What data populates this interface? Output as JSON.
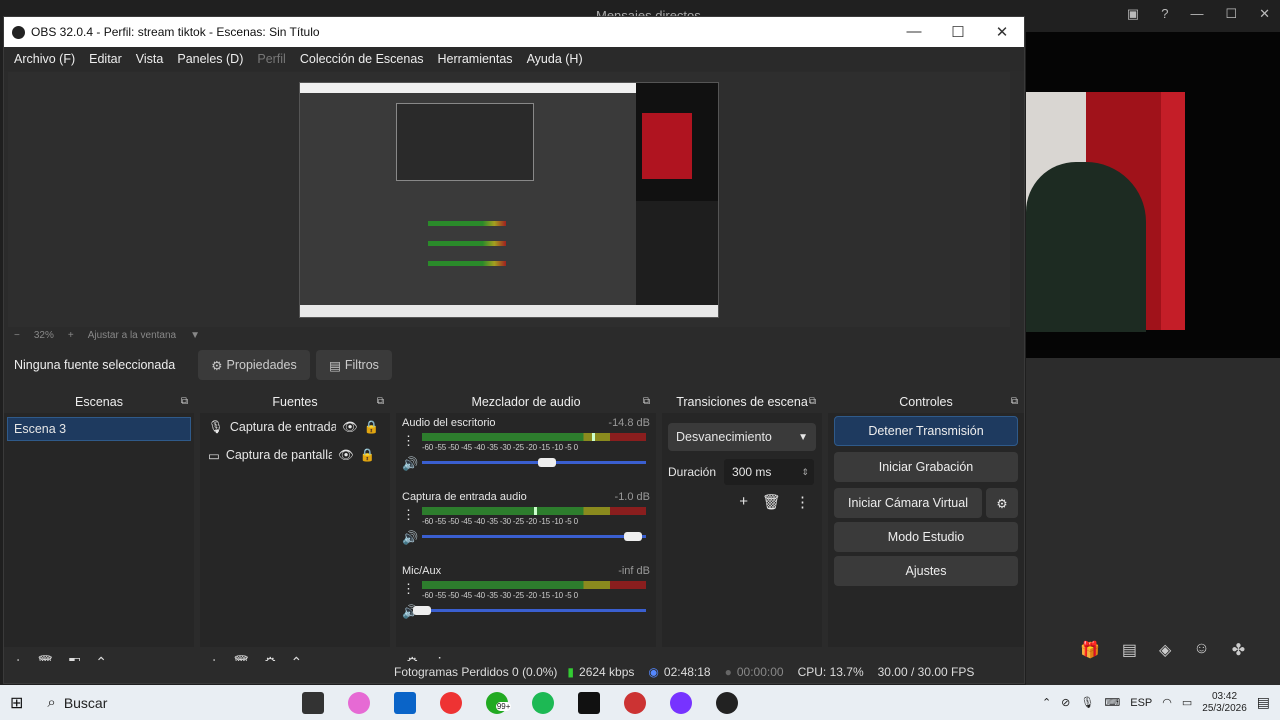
{
  "background": {
    "title": "Mensajes directos"
  },
  "window": {
    "title": "OBS 32.0.4 - Perfil: stream tiktok - Escenas: Sin Título",
    "minimize": "—",
    "maximize": "☐",
    "close": "✕"
  },
  "menu": {
    "items": [
      "Archivo (F)",
      "Editar",
      "Vista",
      "Paneles (D)",
      "Perfil",
      "Colección de Escenas",
      "Herramientas",
      "Ayuda (H)"
    ]
  },
  "preview": {
    "zoom_minus": "−",
    "zoom": "32%",
    "zoom_plus": "+",
    "fit": "Ajustar a la ventana"
  },
  "source_bar": {
    "label": "Ninguna fuente seleccionada",
    "properties": "Propiedades",
    "filters": "Filtros"
  },
  "scenes": {
    "title": "Escenas",
    "items": [
      "Escena 3"
    ]
  },
  "sources": {
    "title": "Fuentes",
    "items": [
      "Captura de entrada",
      "Captura de pantalla"
    ]
  },
  "mixer": {
    "title": "Mezclador de audio",
    "scale": "-60 -55 -50 -45 -40 -35 -30 -25 -20 -15 -10 -5 0",
    "channels": [
      {
        "name": "Audio del escritorio",
        "db": "-14.8 dB",
        "level": 0.76,
        "volume": 0.56
      },
      {
        "name": "Captura de entrada audio",
        "db": "-1.0 dB",
        "level": 0.5,
        "volume": 0.94
      },
      {
        "name": "Mic/Aux",
        "db": "-inf dB",
        "level": 0.0,
        "volume": 0.0
      }
    ]
  },
  "transitions": {
    "title": "Transiciones de escena",
    "selected": "Desvanecimiento",
    "duration_label": "Duración",
    "duration": "300 ms"
  },
  "controls": {
    "title": "Controles",
    "stop_stream": "Detener Transmisión",
    "start_record": "Iniciar Grabación",
    "virtual_cam": "Iniciar Cámara Virtual",
    "studio": "Modo Estudio",
    "settings": "Ajustes",
    "accent": "#1e3a5f"
  },
  "status": {
    "dropped": "Fotogramas Perdidos 0 (0.0%)",
    "bitrate": "2624 kbps",
    "stream_time": "02:48:18",
    "record_time": "00:00:00",
    "cpu": "CPU: 13.7%",
    "fps": "30.00 / 30.00 FPS"
  },
  "taskbar": {
    "search": "Buscar",
    "lang": "ESP",
    "time": "03:42",
    "date": "25/3/2026",
    "whatsapp_badge": "99+"
  }
}
